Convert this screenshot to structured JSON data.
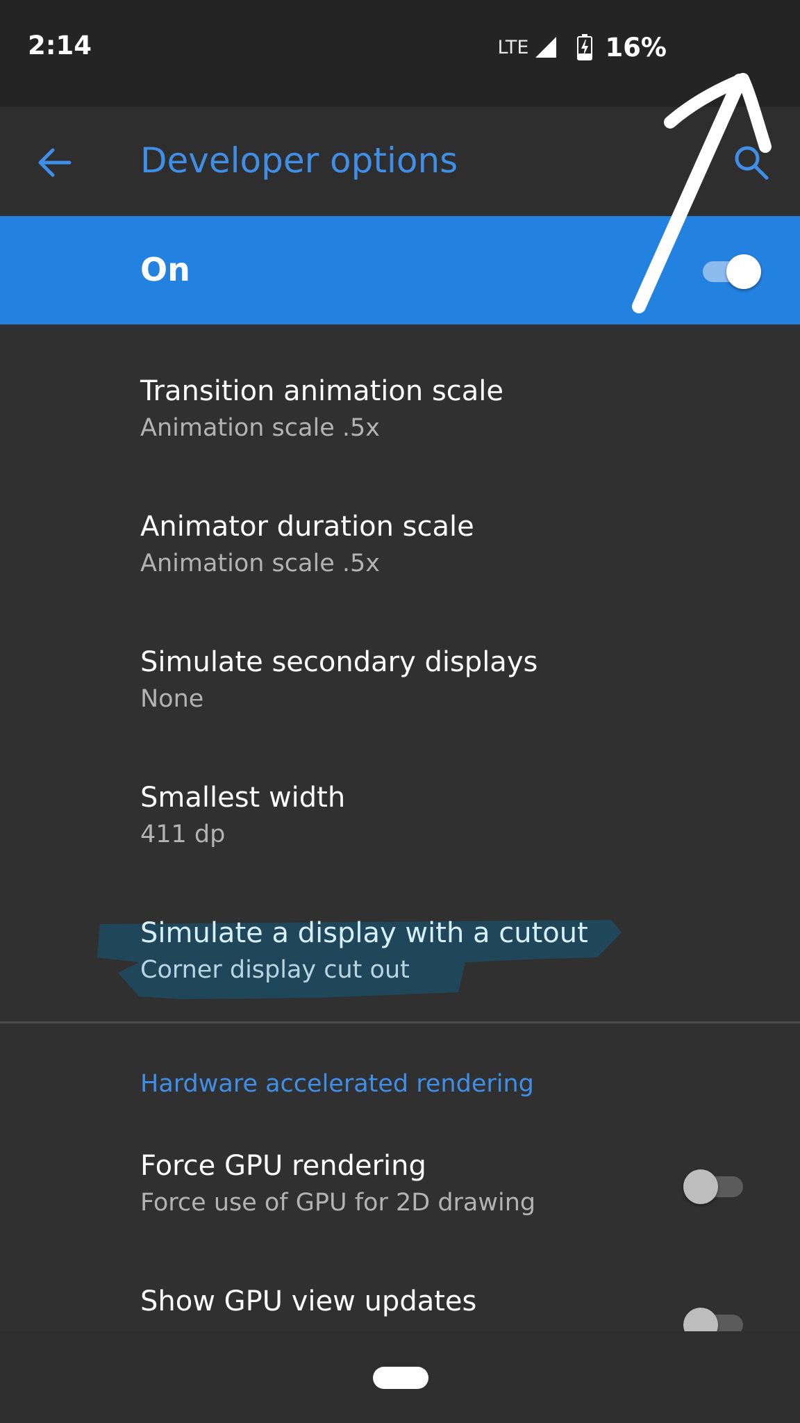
{
  "status_bar": {
    "time": "2:14",
    "network": "LTE",
    "battery": "16%"
  },
  "app_bar": {
    "back_icon": "arrow-back-icon",
    "title": "Developer options",
    "search_icon": "search-icon"
  },
  "master_switch": {
    "label": "On",
    "enabled": true
  },
  "settings": [
    {
      "title": "Transition animation scale",
      "summary": "Animation scale .5x"
    },
    {
      "title": "Animator duration scale",
      "summary": "Animation scale .5x"
    },
    {
      "title": "Simulate secondary displays",
      "summary": "None"
    },
    {
      "title": "Smallest width",
      "summary": "411 dp"
    },
    {
      "title": "Simulate a display with a cutout",
      "summary": "Corner display cut out"
    }
  ],
  "category": {
    "title": "Hardware accelerated rendering"
  },
  "hardware_settings": [
    {
      "title": "Force GPU rendering",
      "summary": "Force use of GPU for 2D drawing",
      "enabled": false
    },
    {
      "title": "Show GPU view updates",
      "enabled": false
    }
  ],
  "colors": {
    "accent": "#3f8fe8",
    "master_bar": "#2381e0",
    "background": "#303030",
    "highlight": "#1f4a5e"
  },
  "annotation": {
    "arrow_icon": "hand-drawn-arrow-icon"
  }
}
